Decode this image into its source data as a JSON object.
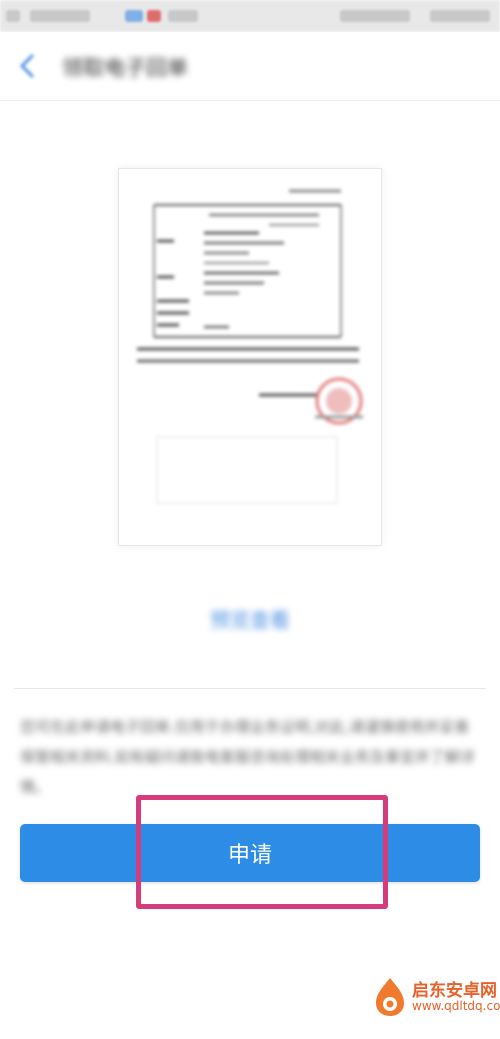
{
  "header": {
    "title": "领取电子回单"
  },
  "preview": {
    "link_label": "预览查看"
  },
  "description": {
    "text": "您可在此申请电子回单,仅用于办理业务证明,对此,请谨慎使用并妥善保管相关资料,如有疑问请致电客服咨询处理相关业务及事宜并了解详情。"
  },
  "action": {
    "apply_label": "申请"
  },
  "watermark": {
    "name": "启东安卓网",
    "url": "www.qdltdq.com"
  },
  "colors": {
    "primary": "#2d8ce6",
    "highlight": "#d63b7b",
    "watermark": "#e8612a"
  },
  "icons": {
    "back": "chevron-left-icon",
    "stamp": "red-seal-icon",
    "watermark_logo": "flame-logo-icon"
  }
}
